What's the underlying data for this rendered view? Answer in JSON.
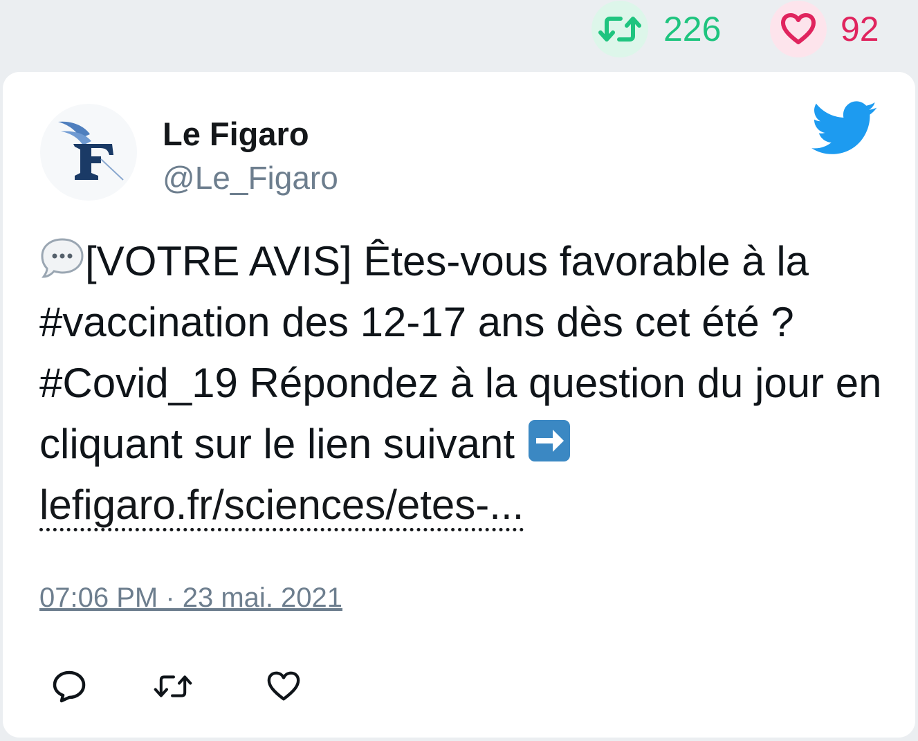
{
  "stats": {
    "retweet_count": "226",
    "like_count": "92"
  },
  "tweet": {
    "author_name": "Le Figaro",
    "author_handle": "@Le_Figaro",
    "text_part1": "[VOTRE AVIS] Êtes-vous favorable à la #vaccination des 12-17 ans dès cet été ? #Covid_19 Répondez à la question du jour en cliquant sur le lien suivant ",
    "link_text": "lefigaro.fr/sciences/etes-...",
    "timestamp": "07:06 PM · 23 mai. 2021"
  },
  "icons": {
    "speech_bubble": "speech-bubble-emoji",
    "arrow_right": "right-arrow-emoji",
    "brand": "twitter-bird-icon"
  },
  "colors": {
    "retweet": "#1fc47f",
    "like": "#e0245e",
    "twitter_blue": "#1d9bf0",
    "muted": "#6d7e8e"
  }
}
